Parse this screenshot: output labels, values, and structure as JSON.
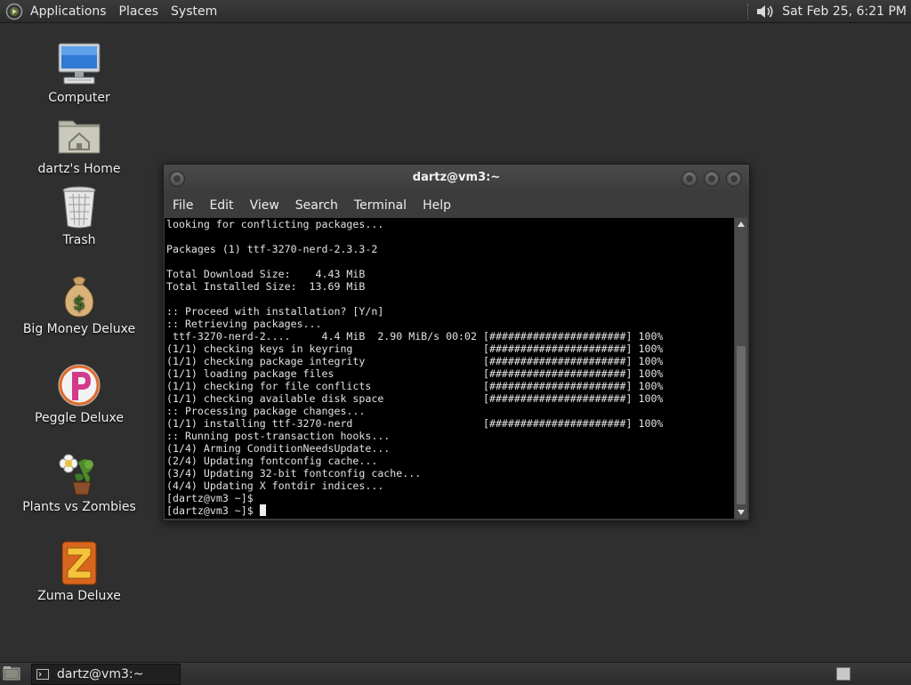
{
  "top_panel": {
    "menus": [
      "Applications",
      "Places",
      "System"
    ],
    "clock": "Sat Feb 25,  6:21 PM",
    "icons": [
      "app-logo-icon",
      "volume-icon"
    ]
  },
  "desktop": {
    "icons": [
      {
        "label": "Computer",
        "icon": "computer-icon"
      },
      {
        "label": "dartz's Home",
        "icon": "home-folder-icon"
      },
      {
        "label": "Trash",
        "icon": "trash-icon"
      },
      {
        "label": "Big Money Deluxe",
        "icon": "money-bag-icon"
      },
      {
        "label": "Peggle Deluxe",
        "icon": "peggle-icon"
      },
      {
        "label": "Plants vs Zombies",
        "icon": "plants-icon"
      },
      {
        "label": "Zuma Deluxe",
        "icon": "zuma-icon"
      }
    ]
  },
  "terminal": {
    "title": "dartz@vm3:~",
    "menus": [
      "File",
      "Edit",
      "View",
      "Search",
      "Terminal",
      "Help"
    ],
    "lines": [
      "looking for conflicting packages...",
      "",
      "Packages (1) ttf-3270-nerd-2.3.3-2",
      "",
      "Total Download Size:    4.43 MiB",
      "Total Installed Size:  13.69 MiB",
      "",
      ":: Proceed with installation? [Y/n]",
      ":: Retrieving packages...",
      " ttf-3270-nerd-2....     4.4 MiB  2.90 MiB/s 00:02 [######################] 100%",
      "(1/1) checking keys in keyring                     [######################] 100%",
      "(1/1) checking package integrity                   [######################] 100%",
      "(1/1) loading package files                        [######################] 100%",
      "(1/1) checking for file conflicts                  [######################] 100%",
      "(1/1) checking available disk space                [######################] 100%",
      ":: Processing package changes...",
      "(1/1) installing ttf-3270-nerd                     [######################] 100%",
      ":: Running post-transaction hooks...",
      "(1/4) Arming ConditionNeedsUpdate...",
      "(2/4) Updating fontconfig cache...",
      "(3/4) Updating 32-bit fontconfig cache...",
      "(4/4) Updating X fontdir indices...",
      "[dartz@vm3 ~]$",
      "[dartz@vm3 ~]$ "
    ]
  },
  "bottom_panel": {
    "task_label": "dartz@vm3:~",
    "task_icon": "terminal-icon"
  }
}
